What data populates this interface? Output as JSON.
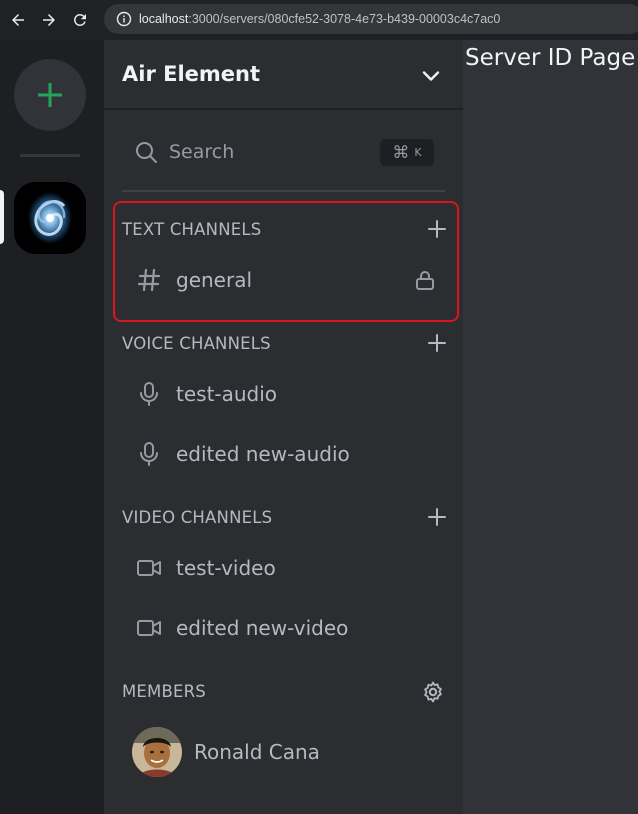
{
  "browser": {
    "url_host": "localhost",
    "url_rest": ":3000/servers/080cfe52-3078-4e73-b439-00003c4c7ac0"
  },
  "server": {
    "name": "Air Element"
  },
  "search": {
    "label": "Search",
    "shortcut_key": "K"
  },
  "sections": {
    "text": {
      "label": "TEXT CHANNELS",
      "channels": [
        {
          "label": "general"
        }
      ]
    },
    "voice": {
      "label": "VOICE CHANNELS",
      "channels": [
        {
          "label": "test-audio"
        },
        {
          "label": "edited new-audio"
        }
      ]
    },
    "video": {
      "label": "VIDEO CHANNELS",
      "channels": [
        {
          "label": "test-video"
        },
        {
          "label": "edited new-video"
        }
      ]
    },
    "members": {
      "label": "MEMBERS",
      "list": [
        {
          "name": "Ronald Cana"
        }
      ]
    }
  },
  "main": {
    "title": "Server ID Page"
  },
  "colors": {
    "accent_green": "#23a55a",
    "highlight_red": "#d8161c"
  }
}
